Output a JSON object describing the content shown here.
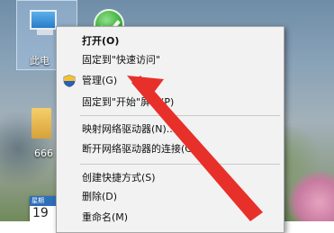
{
  "desktop": {
    "this_pc_label": "此电",
    "folder_label": "666",
    "calendar_week": "星期",
    "calendar_day": "19"
  },
  "context_menu": {
    "items": [
      {
        "label": "打开(O)",
        "bold": true
      },
      {
        "label": "固定到\"快速访问\""
      },
      {
        "label": "管理(G)",
        "icon": "uac-shield-icon"
      },
      {
        "label": "固定到\"开始\"屏幕(P)"
      },
      {
        "label": "映射网络驱动器(N)..."
      },
      {
        "label": "断开网络驱动器的连接(C)..."
      },
      {
        "label": "创建快捷方式(S)"
      },
      {
        "label": "删除(D)"
      },
      {
        "label": "重命名(M)"
      }
    ]
  },
  "annotation": {
    "arrow_color": "#e8302a"
  }
}
